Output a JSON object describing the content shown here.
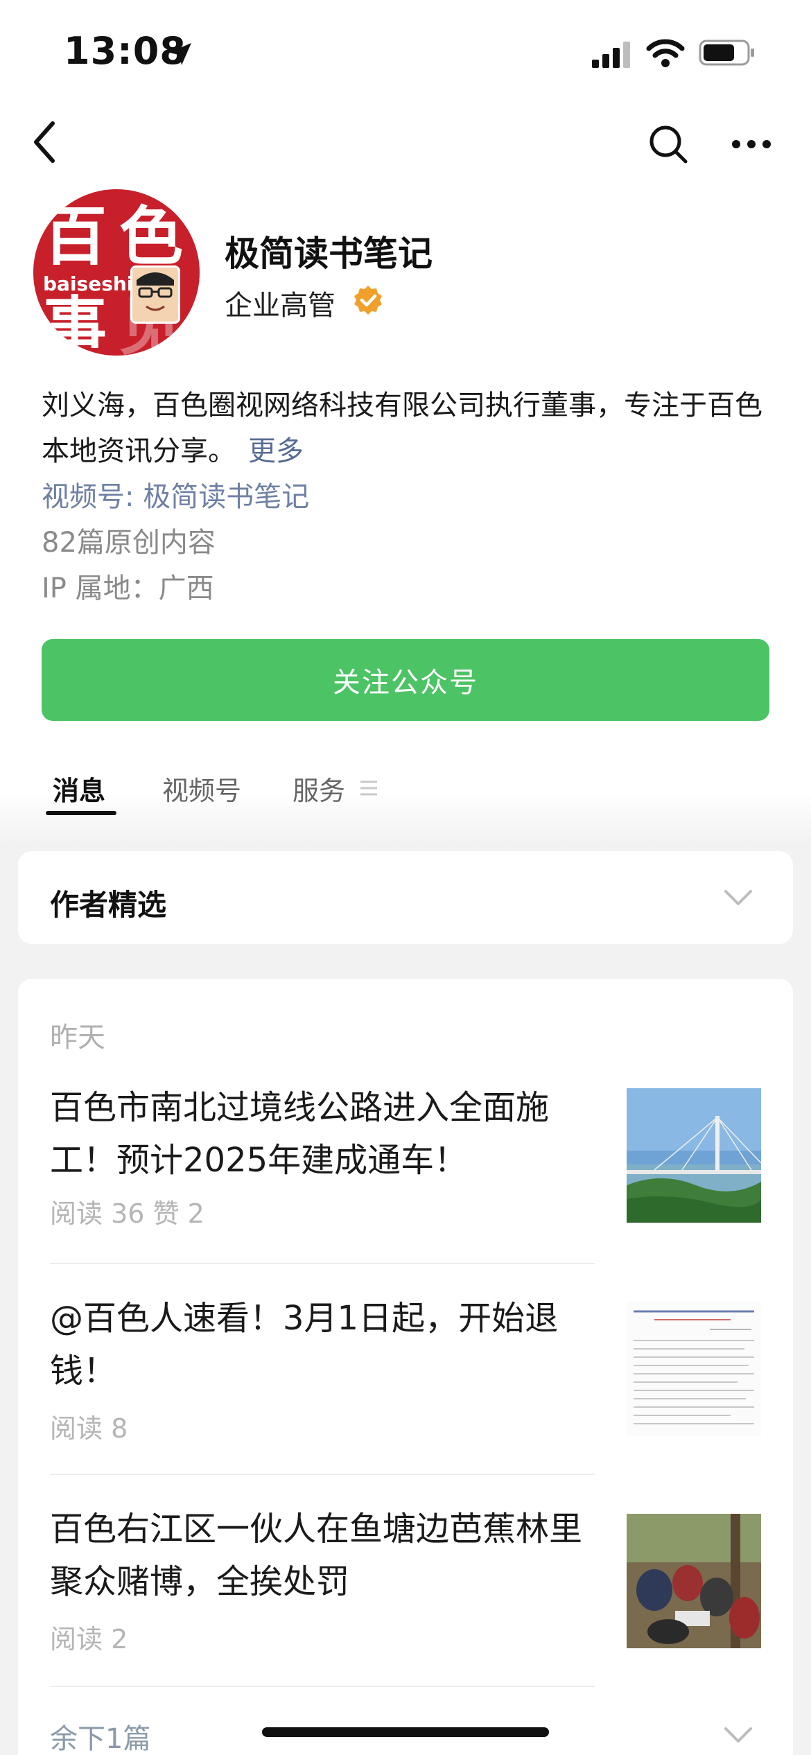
{
  "status_bar": {
    "time": "13:08"
  },
  "account": {
    "avatar_text": {
      "char1": "百",
      "char2": "色",
      "char3": "事",
      "char4": "见",
      "sub": "baiseshi"
    },
    "name": "极简读书笔记",
    "role": "企业高管",
    "bio": "刘义海，百色圈视网络科技有限公司执行董事，专注于百色本地资讯分享。",
    "bio_more": "更多",
    "channel": "视频号: 极简读书笔记",
    "original_count": "82篇原创内容",
    "ip_location": "IP 属地：广西"
  },
  "follow_button": "关注公众号",
  "tabs": [
    {
      "label": "消息"
    },
    {
      "label": "视频号"
    },
    {
      "label": "服务"
    }
  ],
  "author_picks": {
    "title": "作者精选"
  },
  "feed": {
    "day_label": "昨天",
    "articles": [
      {
        "title": "百色市南北过境线公路进入全面施工！预计2025年建成通车！",
        "stats": "阅读 36   赞 2"
      },
      {
        "title": "@百色人速看！3月1日起，开始退钱！",
        "stats": "阅读 8"
      },
      {
        "title": "百色右江区一伙人在鱼塘边芭蕉林里聚众赌博，全挨处罚",
        "stats": "阅读 2"
      }
    ],
    "remaining": "余下1篇"
  },
  "colors": {
    "accent_green": "#4cc364",
    "link_blue": "#576b95",
    "brand_red": "#c8202b",
    "badge_orange": "#f0a12c"
  }
}
